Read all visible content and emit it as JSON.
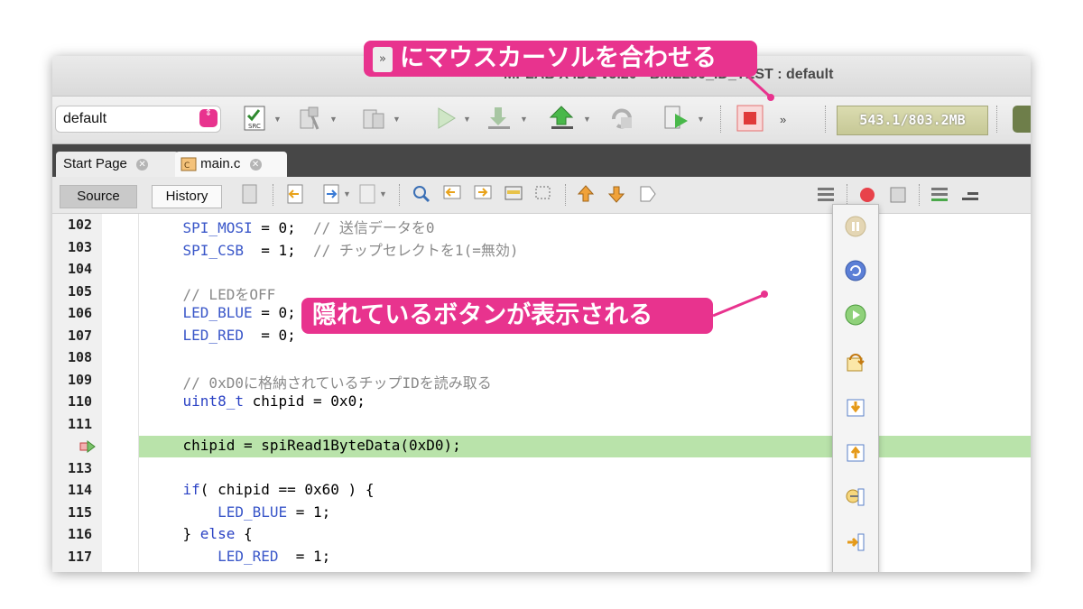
{
  "window": {
    "title": "MPLAB X IDE v5.20 - BME280_ID_TEST : default"
  },
  "toolbar": {
    "config_value": "default",
    "memory": "543.1/803.2MB",
    "overflow_icon": "chevron-double-down-icon"
  },
  "tabs": [
    {
      "label": "Start Page"
    },
    {
      "label": "main.c"
    }
  ],
  "editor_tabs": {
    "source": "Source",
    "history": "History"
  },
  "code": {
    "current_line_marker": "program-counter-arrow-icon",
    "lines": [
      {
        "num": "102",
        "parts": [
          {
            "t": "    SPI_MOSI",
            "c": "blue"
          },
          {
            "t": " = 0;  ",
            "c": ""
          },
          {
            "t": "// 送信データを0",
            "c": "cm"
          }
        ]
      },
      {
        "num": "103",
        "parts": [
          {
            "t": "    SPI_CSB",
            "c": "blue"
          },
          {
            "t": "  = 1;  ",
            "c": ""
          },
          {
            "t": "// チップセレクトを1(=無効)",
            "c": "cm"
          }
        ]
      },
      {
        "num": "104",
        "parts": []
      },
      {
        "num": "105",
        "parts": [
          {
            "t": "    // LEDをOFF",
            "c": "cm"
          }
        ]
      },
      {
        "num": "106",
        "parts": [
          {
            "t": "    LED_BLUE",
            "c": "blue"
          },
          {
            "t": " = 0;",
            "c": ""
          }
        ]
      },
      {
        "num": "107",
        "parts": [
          {
            "t": "    LED_RED",
            "c": "blue"
          },
          {
            "t": "  = 0;",
            "c": ""
          }
        ]
      },
      {
        "num": "108",
        "parts": []
      },
      {
        "num": "109",
        "parts": [
          {
            "t": "    // 0xD0に格納されているチップIDを読み取る",
            "c": "cm"
          }
        ]
      },
      {
        "num": "110",
        "parts": [
          {
            "t": "    uint8_t",
            "c": "kw"
          },
          {
            "t": " chipid = 0x0;",
            "c": ""
          }
        ]
      },
      {
        "num": "111",
        "parts": []
      },
      {
        "num": "",
        "parts": [
          {
            "t": "    chipid = spiRead1ByteData(0xD0);",
            "c": ""
          }
        ],
        "current": true
      },
      {
        "num": "113",
        "parts": []
      },
      {
        "num": "114",
        "parts": [
          {
            "t": "    if",
            "c": "kw"
          },
          {
            "t": "( chipid == 0x60 ) {",
            "c": ""
          }
        ]
      },
      {
        "num": "115",
        "parts": [
          {
            "t": "        LED_BLUE",
            "c": "blue"
          },
          {
            "t": " = 1;",
            "c": ""
          }
        ]
      },
      {
        "num": "116",
        "parts": [
          {
            "t": "    } ",
            "c": ""
          },
          {
            "t": "else",
            "c": "kw"
          },
          {
            "t": " {",
            "c": ""
          }
        ]
      },
      {
        "num": "117",
        "parts": [
          {
            "t": "        LED_RED",
            "c": "blue"
          },
          {
            "t": "  = 1;",
            "c": ""
          }
        ]
      }
    ]
  },
  "hidden_buttons": [
    "pause-icon",
    "reset-icon",
    "continue-icon",
    "step-over-icon",
    "step-into-icon",
    "step-out-icon",
    "run-to-cursor-icon",
    "set-pc-at-cursor-icon",
    "focus-cursor-at-pc-icon"
  ],
  "annotations": {
    "top": "にマウスカーソルを合わせる",
    "middle": "隠れているボタンが表示される",
    "color": "#e8338e"
  }
}
